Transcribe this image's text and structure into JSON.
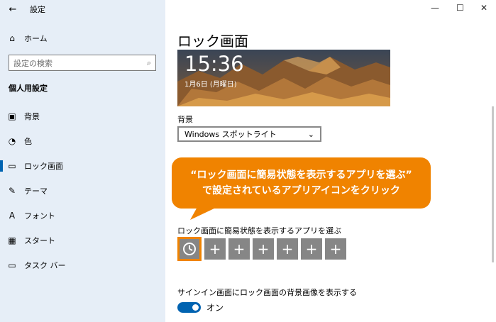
{
  "window": {
    "title": "設定",
    "back_icon": "←",
    "minimize": "—",
    "maximize": "☐",
    "close": "✕"
  },
  "sidebar": {
    "home": "ホーム",
    "search_placeholder": "設定の検索",
    "section": "個人用設定",
    "items": [
      {
        "label": "背景",
        "icon": "🖼"
      },
      {
        "label": "色",
        "icon": "🎨"
      },
      {
        "label": "ロック画面",
        "icon": "▭"
      },
      {
        "label": "テーマ",
        "icon": "🖌"
      },
      {
        "label": "フォント",
        "icon": "A"
      },
      {
        "label": "スタート",
        "icon": "▦"
      },
      {
        "label": "タスク バー",
        "icon": "▭"
      }
    ]
  },
  "main": {
    "page_title": "ロック画面",
    "preview_time": "15:36",
    "preview_date": "1月6日 (月曜日)",
    "background_label": "背景",
    "background_value": "Windows スポットライト",
    "quick_status_label": "ロック画面に簡易状態を表示するアプリを選ぶ",
    "tiles": [
      "",
      "+",
      "+",
      "+",
      "+",
      "+",
      "+"
    ],
    "signin_label": "サインイン画面にロック画面の背景画像を表示する",
    "toggle_state": "オン"
  },
  "callout": {
    "line1": "“ロック画面に簡易状態を表示するアプリを選ぶ”",
    "line2": "で設定されているアプリアイコンをクリック"
  },
  "colors": {
    "accent": "#0063b1",
    "callout": "#f08300",
    "sidebar_bg": "#e6eef7",
    "tile": "#868686"
  }
}
